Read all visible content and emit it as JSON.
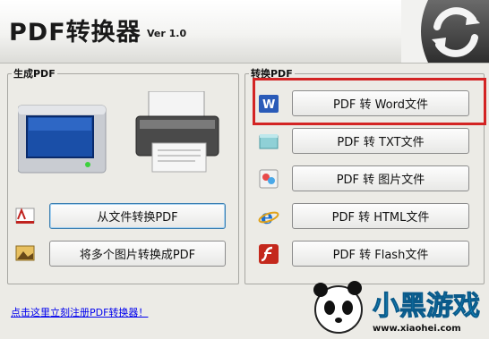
{
  "app": {
    "title": "PDF转换器",
    "version": "Ver 1.0"
  },
  "generate_group": {
    "label": "生成PDF",
    "buttons": [
      {
        "label": "从文件转换PDF",
        "icon": "pdf-file-icon"
      },
      {
        "label": "将多个图片转换成PDF",
        "icon": "image-icon"
      }
    ]
  },
  "convert_group": {
    "label": "转换PDF",
    "buttons": [
      {
        "label": "PDF 转 Word文件",
        "icon": "word-icon"
      },
      {
        "label": "PDF 转 TXT文件",
        "icon": "txt-icon"
      },
      {
        "label": "PDF 转 图片文件",
        "icon": "picture-icon"
      },
      {
        "label": "PDF 转 HTML文件",
        "icon": "ie-icon"
      },
      {
        "label": "PDF 转 Flash文件",
        "icon": "flash-icon"
      }
    ]
  },
  "register_link": "点击这里立刻注册PDF转换器！",
  "watermark": {
    "text": "小黑游戏",
    "url": "www.xiaohei.com"
  },
  "colors": {
    "highlight": "#d32424",
    "link": "#0000ee"
  }
}
